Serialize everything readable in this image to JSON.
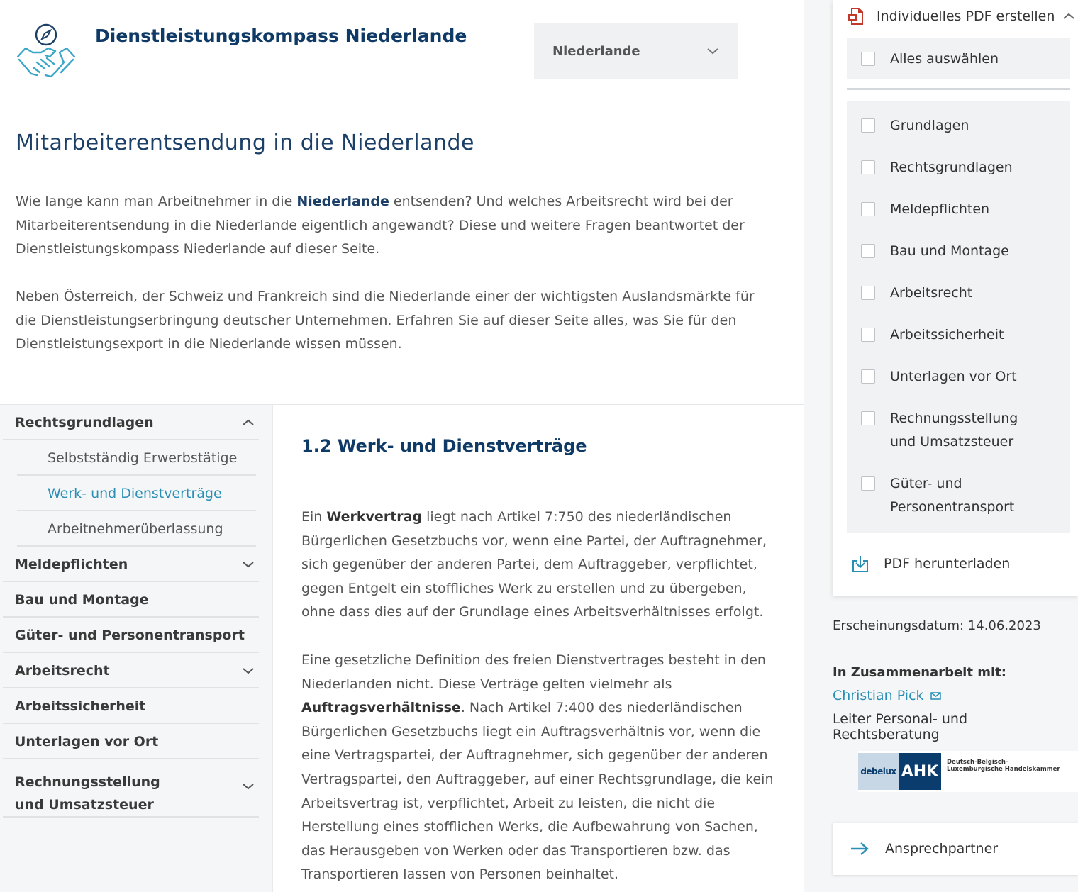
{
  "header": {
    "brand": "Dienstleistungskompass Niederlande",
    "country_select": {
      "value": "Niederlande"
    }
  },
  "page": {
    "title": "Mitarbeiterentsendung in die Niederlande",
    "intro1_a": "Wie lange kann man Arbeitnehmer in die ",
    "intro1_b": "Niederlande",
    "intro1_c": " entsenden? Und welches Arbeitsrecht wird bei der Mitarbeiterentsendung in die Niederlande eigentlich angewandt? Diese und weitere Fragen beantwortet der Dienstleistungskompass Niederlande auf dieser Seite.",
    "intro2": "Neben Österreich, der Schweiz und Frankreich sind die Niederlande einer der wichtigsten Auslandsmärkte für die Dienstleistungserbringung deutscher Unternehmen. Erfahren Sie auf dieser Seite alles, was Sie für den Dienstleistungsexport in die Niederlande wissen müssen."
  },
  "nav": {
    "items": [
      {
        "label": "Rechtsgrundlagen"
      },
      {
        "label": "Meldepflichten"
      },
      {
        "label": "Bau und Montage"
      },
      {
        "label": "Güter- und Personentransport"
      },
      {
        "label": "Arbeitsrecht"
      },
      {
        "label": "Arbeitssicherheit"
      },
      {
        "label": "Unterlagen vor Ort"
      },
      {
        "label": "Rechnungsstellung und Umsatzsteuer"
      }
    ],
    "subitems": [
      {
        "label": "Selbstständig Erwerbstätige"
      },
      {
        "label": "Werk- und Dienstverträge"
      },
      {
        "label": "Arbeitnehmerüberlassung"
      }
    ]
  },
  "article": {
    "title": "1.2 Werk- und Dienstverträge",
    "p1_a": "Ein ",
    "p1_b": "Werkvertrag",
    "p1_c": " liegt nach Artikel 7:750 des niederländischen Bürgerlichen Gesetzbuchs vor, wenn eine Partei, der Auftragnehmer, sich gegenüber der anderen Partei, dem Auftraggeber, verpflichtet, gegen Entgelt ein stoffliches Werk zu erstellen und zu übergeben, ohne dass dies auf der Grundlage eines Arbeitsverhältnisses erfolgt.",
    "p2_a": "Eine gesetzliche Definition des freien Dienstvertrages besteht in den Niederlanden nicht. Diese Verträge gelten vielmehr als ",
    "p2_b": "Auftragsverhältnisse",
    "p2_c": ". Nach Artikel 7:400 des niederländischen Bürgerlichen Gesetzbuchs liegt ein Auftragsverhältnis vor, wenn die eine Vertragspartei, der Auftragnehmer, sich gegenüber der anderen Vertragspartei, den Auftraggeber, auf einer Rechtsgrundlage, die kein Arbeitsvertrag ist, verpflichtet, Arbeit zu leisten, die nicht die Herstellung eines stofflichen Werks, die Aufbewahrung von Sachen, das Herausgeben von Werken oder das Transportieren bzw. das Transportieren lassen von Personen beinhaltet."
  },
  "pdf": {
    "header": "Individuelles PDF erstellen",
    "select_all": "Alles auswählen",
    "options": [
      {
        "label": "Grundlagen"
      },
      {
        "label": "Rechtsgrundlagen"
      },
      {
        "label": "Meldepflichten"
      },
      {
        "label": "Bau und Montage"
      },
      {
        "label": "Arbeitsrecht"
      },
      {
        "label": "Arbeitssicherheit"
      },
      {
        "label": "Unterlagen vor Ort"
      },
      {
        "label": "Rechnungsstellung und Umsatzsteuer"
      },
      {
        "label": "Güter- und Personentransport"
      }
    ],
    "download": "PDF herunterladen"
  },
  "meta": {
    "date": "Erscheinungsdatum: 14.06.2023",
    "coop_label": "In Zusammenarbeit mit:",
    "contact_name": "Christian Pick",
    "contact_role": "Leiter Personal- und Rechtsberatung"
  },
  "partner_logo": {
    "part1": "debelux",
    "part2": "AHK",
    "subtitle": "Deutsch-Belgisch-Luxemburgische Handelskammer"
  },
  "contact_button": "Ansprechpartner",
  "colors": {
    "brand_navy": "#0f3a66",
    "link_blue": "#2a8fb5",
    "panel_gray": "#f5f6f7"
  },
  "icons": {
    "logo": "handshake-compass-icon",
    "pdf": "pdf-file-icon",
    "download": "download-icon",
    "arrow": "arrow-right-icon",
    "mail": "mail-icon",
    "chevron_up": "chevron-up-icon",
    "chevron_down": "chevron-down-icon"
  }
}
